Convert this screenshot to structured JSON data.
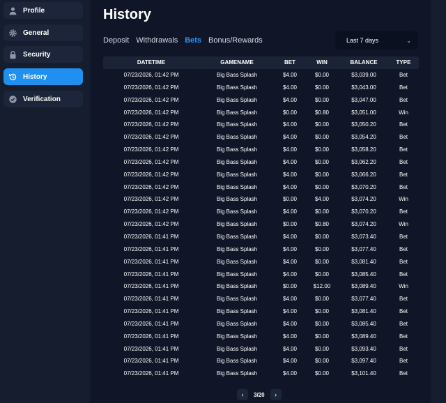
{
  "sidebar": {
    "items": [
      {
        "label": "Profile",
        "icon": "user-icon"
      },
      {
        "label": "General",
        "icon": "gear-icon"
      },
      {
        "label": "Security",
        "icon": "lock-icon"
      },
      {
        "label": "History",
        "icon": "history-icon",
        "active": true
      },
      {
        "label": "Verification",
        "icon": "check-circle-icon"
      }
    ]
  },
  "page": {
    "title": "History"
  },
  "tabs": [
    {
      "label": "Deposit"
    },
    {
      "label": "Withdrawals"
    },
    {
      "label": "Bets",
      "active": true
    },
    {
      "label": "Bonus/Rewards"
    }
  ],
  "filter": {
    "selected": "Last 7 days"
  },
  "table": {
    "headers": [
      "DATETIME",
      "GAMENAME",
      "BET",
      "WIN",
      "BALANCE",
      "TYPE"
    ],
    "rows": [
      [
        "07/23/2026, 01:42 PM",
        "Big Bass Splash",
        "$4.00",
        "$0.00",
        "$3,039.00",
        "Bet"
      ],
      [
        "07/23/2026, 01:42 PM",
        "Big Bass Splash",
        "$4.00",
        "$0.00",
        "$3,043.00",
        "Bet"
      ],
      [
        "07/23/2026, 01:42 PM",
        "Big Bass Splash",
        "$4.00",
        "$0.00",
        "$3,047.00",
        "Bet"
      ],
      [
        "07/23/2026, 01:42 PM",
        "Big Bass Splash",
        "$0.00",
        "$0.80",
        "$3,051.00",
        "Win"
      ],
      [
        "07/23/2026, 01:42 PM",
        "Big Bass Splash",
        "$4.00",
        "$0.00",
        "$3,050.20",
        "Bet"
      ],
      [
        "07/23/2026, 01:42 PM",
        "Big Bass Splash",
        "$4.00",
        "$0.00",
        "$3,054.20",
        "Bet"
      ],
      [
        "07/23/2026, 01:42 PM",
        "Big Bass Splash",
        "$4.00",
        "$0.00",
        "$3,058.20",
        "Bet"
      ],
      [
        "07/23/2026, 01:42 PM",
        "Big Bass Splash",
        "$4.00",
        "$0.00",
        "$3,062.20",
        "Bet"
      ],
      [
        "07/23/2026, 01:42 PM",
        "Big Bass Splash",
        "$4.00",
        "$0.00",
        "$3,066.20",
        "Bet"
      ],
      [
        "07/23/2026, 01:42 PM",
        "Big Bass Splash",
        "$4.00",
        "$0.00",
        "$3,070.20",
        "Bet"
      ],
      [
        "07/23/2026, 01:42 PM",
        "Big Bass Splash",
        "$0.00",
        "$4.00",
        "$3,074.20",
        "Win"
      ],
      [
        "07/23/2026, 01:42 PM",
        "Big Bass Splash",
        "$4.00",
        "$0.00",
        "$3,070.20",
        "Bet"
      ],
      [
        "07/23/2026, 01:42 PM",
        "Big Bass Splash",
        "$0.00",
        "$0.80",
        "$3,074.20",
        "Win"
      ],
      [
        "07/23/2026, 01:41 PM",
        "Big Bass Splash",
        "$4.00",
        "$0.00",
        "$3,073.40",
        "Bet"
      ],
      [
        "07/23/2026, 01:41 PM",
        "Big Bass Splash",
        "$4.00",
        "$0.00",
        "$3,077.40",
        "Bet"
      ],
      [
        "07/23/2026, 01:41 PM",
        "Big Bass Splash",
        "$4.00",
        "$0.00",
        "$3,081.40",
        "Bet"
      ],
      [
        "07/23/2026, 01:41 PM",
        "Big Bass Splash",
        "$4.00",
        "$0.00",
        "$3,085.40",
        "Bet"
      ],
      [
        "07/23/2026, 01:41 PM",
        "Big Bass Splash",
        "$0.00",
        "$12.00",
        "$3,089.40",
        "Win"
      ],
      [
        "07/23/2026, 01:41 PM",
        "Big Bass Splash",
        "$4.00",
        "$0.00",
        "$3,077.40",
        "Bet"
      ],
      [
        "07/23/2026, 01:41 PM",
        "Big Bass Splash",
        "$4.00",
        "$0.00",
        "$3,081.40",
        "Bet"
      ],
      [
        "07/23/2026, 01:41 PM",
        "Big Bass Splash",
        "$4.00",
        "$0.00",
        "$3,085.40",
        "Bet"
      ],
      [
        "07/23/2026, 01:41 PM",
        "Big Bass Splash",
        "$4.00",
        "$0.00",
        "$3,089.40",
        "Bet"
      ],
      [
        "07/23/2026, 01:41 PM",
        "Big Bass Splash",
        "$4.00",
        "$0.00",
        "$3,093.40",
        "Bet"
      ],
      [
        "07/23/2026, 01:41 PM",
        "Big Bass Splash",
        "$4.00",
        "$0.00",
        "$3,097.40",
        "Bet"
      ],
      [
        "07/23/2026, 01:41 PM",
        "Big Bass Splash",
        "$4.00",
        "$0.00",
        "$3,101.40",
        "Bet"
      ]
    ]
  },
  "pagination": {
    "label": "3/20",
    "prev_icon": "chevron-left-icon",
    "next_icon": "chevron-right-icon"
  }
}
